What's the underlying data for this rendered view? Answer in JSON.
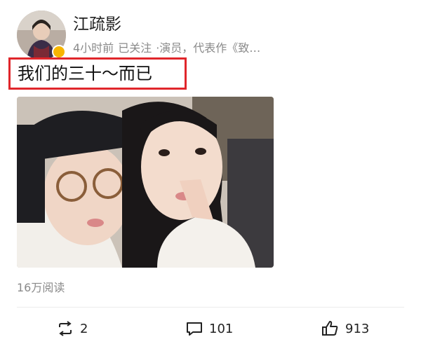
{
  "header": {
    "username": "江疏影",
    "time": "4小时前",
    "follow_status": "已关注",
    "description": "·演员，代表作《致…"
  },
  "post": {
    "text": "我们的三十～而已",
    "views": "16万阅读"
  },
  "actions": {
    "repost_count": "2",
    "comment_count": "101",
    "like_count": "913"
  },
  "icons": {
    "repost": "repost-icon",
    "comment": "comment-icon",
    "like": "thumbs-up-icon"
  },
  "colors": {
    "highlight_border": "#e0262b",
    "meta_text": "#8a8a8a"
  }
}
